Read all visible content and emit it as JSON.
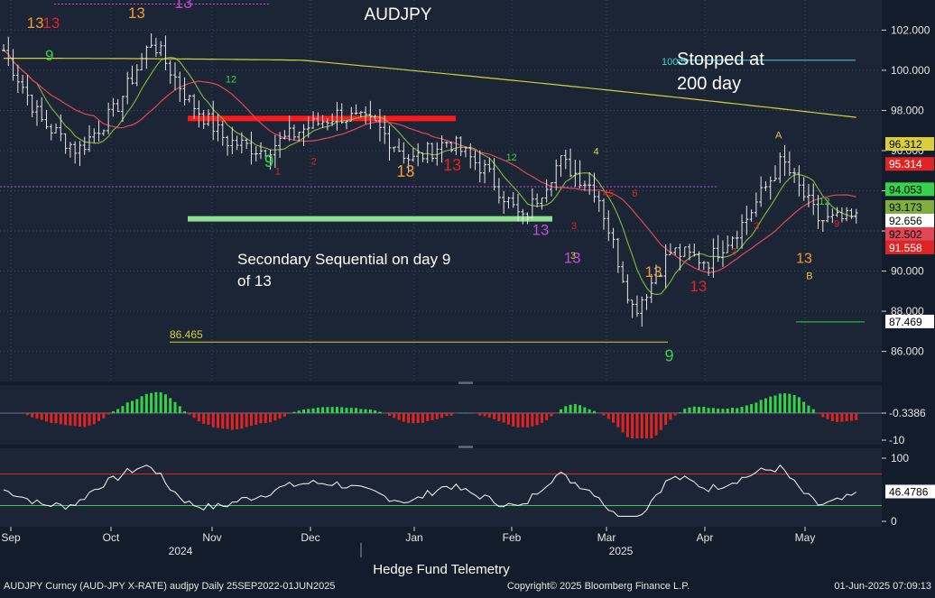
{
  "colors": {
    "bg": "#131c2b",
    "panel": "#1b2536",
    "grid": "#3a4558",
    "candle": "#e8e8e8",
    "ma_red": "#e0485a",
    "ma_green": "#7fae3c",
    "ma_yellow": "#d9cf3a",
    "hist_pos": "#35d24a",
    "hist_neg": "#e02424",
    "rsi_line": "#ffffff",
    "rsi_upper": "#e02424",
    "rsi_lower": "#35d24a",
    "text": "#e6e6e6"
  },
  "chart_data": {
    "type": "candlestick",
    "title": "AUDJPY",
    "x_ticks": [
      "Sep",
      "Oct",
      "Nov",
      "Dec",
      "Jan",
      "Feb",
      "Mar",
      "Apr",
      "May"
    ],
    "year_labels": [
      "2024",
      "2025"
    ],
    "ylim": [
      84.5,
      103.5
    ],
    "y_ticks": [
      "102.000",
      "100.000",
      "98.000",
      "96.000",
      "94.000",
      "92.000",
      "90.000",
      "88.000",
      "86.000"
    ],
    "annotations": {
      "stopped": "Stopped at\n200 day",
      "stopped_level": "100.5",
      "secondary": "Secondary Sequential on day 9\nof 13",
      "level_86": "86.465"
    },
    "price_labels": [
      {
        "text": "96.312",
        "value": 96.312,
        "bg": "#d9cf3a",
        "fg": "#000000"
      },
      {
        "text": "95.314",
        "value": 95.314,
        "bg": "#e02424",
        "fg": "#ffffff"
      },
      {
        "text": "94.053",
        "value": 94.053,
        "bg": "#35d24a",
        "fg": "#000000"
      },
      {
        "text": "93.173",
        "value": 93.173,
        "bg": "#7fae3c",
        "fg": "#000000"
      },
      {
        "text": "92.502",
        "value": 92.502,
        "bg": "#e0485a",
        "fg": "#000000"
      },
      {
        "text": "92.656",
        "value": 92.656,
        "bg": "#ffffff",
        "fg": "#000000"
      },
      {
        "text": "91.558",
        "value": 91.558,
        "bg": "#e02424",
        "fg": "#ffffff"
      },
      {
        "text": "87.469",
        "value": 87.469,
        "bg": "#ffffff",
        "fg": "#000000"
      }
    ],
    "hist_ticks": [
      "-0.3386",
      "-10"
    ],
    "rsi_ticks": [
      "100",
      "46.4786",
      "0"
    ],
    "rsi_bands": [
      75,
      25
    ],
    "rsi_last": 46.4786,
    "anchors": [
      101,
      97.5,
      96,
      98,
      101.5,
      98.5,
      96.5,
      96,
      97,
      97.8,
      97.3,
      95.5,
      96.5,
      95,
      92.5,
      95.5,
      94,
      88,
      91,
      90.5,
      92.5,
      95.5,
      92.5,
      92.6
    ],
    "seq_counts": [
      {
        "t": "13",
        "x": 0.04,
        "v": 102.1,
        "c": "#f29a2e",
        "s": 17
      },
      {
        "t": "13",
        "x": 0.058,
        "v": 102.1,
        "c": "#e02424",
        "s": 17
      },
      {
        "t": "9",
        "x": 0.056,
        "v": 100.5,
        "c": "#35d24a",
        "s": 17
      },
      {
        "t": "13",
        "x": 0.155,
        "v": 102.6,
        "c": "#f29a2e",
        "s": 17
      },
      {
        "t": "13",
        "x": 0.208,
        "v": 103.1,
        "c": "#c24ad6",
        "s": 18
      },
      {
        "t": "9",
        "x": 0.305,
        "v": 95.2,
        "c": "#35d24a",
        "s": 19
      },
      {
        "t": "13",
        "x": 0.46,
        "v": 94.7,
        "c": "#f29a2e",
        "s": 18
      },
      {
        "t": "13",
        "x": 0.513,
        "v": 95.0,
        "c": "#e02424",
        "s": 18
      },
      {
        "t": "13",
        "x": 0.613,
        "v": 91.8,
        "c": "#c24ad6",
        "s": 17
      },
      {
        "t": "13",
        "x": 0.649,
        "v": 90.4,
        "c": "#c24ad6",
        "s": 17
      },
      {
        "t": "13",
        "x": 0.741,
        "v": 89.7,
        "c": "#f29a2e",
        "s": 17
      },
      {
        "t": "13",
        "x": 0.792,
        "v": 89.0,
        "c": "#e02424",
        "s": 17
      },
      {
        "t": "9",
        "x": 0.759,
        "v": 85.5,
        "c": "#35d24a",
        "s": 18
      },
      {
        "t": "13",
        "x": 0.912,
        "v": 90.4,
        "c": "#f29a2e",
        "s": 16
      },
      {
        "t": "B",
        "x": 0.918,
        "v": 89.6,
        "c": "#d9cf3a",
        "s": 11
      },
      {
        "t": "A",
        "x": 0.883,
        "v": 96.6,
        "c": "#d9cf3a",
        "s": 11
      },
      {
        "t": "1",
        "x": 0.315,
        "v": 94.8,
        "c": "#e02424",
        "s": 11
      },
      {
        "t": "2",
        "x": 0.356,
        "v": 95.3,
        "c": "#e02424",
        "s": 11
      },
      {
        "t": "3",
        "x": 0.651,
        "v": 92.1,
        "c": "#e02424",
        "s": 11
      },
      {
        "t": "45",
        "x": 0.69,
        "v": 93.7,
        "c": "#e02424",
        "s": 11
      },
      {
        "t": "6",
        "x": 0.72,
        "v": 93.7,
        "c": "#e02424",
        "s": 11
      },
      {
        "t": "2",
        "x": 0.832,
        "v": 90.8,
        "c": "#e02424",
        "s": 11
      },
      {
        "t": "3",
        "x": 0.858,
        "v": 92.1,
        "c": "#e02424",
        "s": 11
      },
      {
        "t": "9",
        "x": 0.949,
        "v": 92.2,
        "c": "#e02424",
        "s": 11
      },
      {
        "t": "12",
        "x": 0.262,
        "v": 99.4,
        "c": "#35d24a",
        "s": 11
      },
      {
        "t": "12",
        "x": 0.58,
        "v": 95.5,
        "c": "#35d24a",
        "s": 11
      },
      {
        "t": "12",
        "x": 0.935,
        "v": 93.3,
        "c": "#35d24a",
        "s": 11
      },
      {
        "t": "4",
        "x": 0.676,
        "v": 95.8,
        "c": "#d9cf3a",
        "s": 11
      },
      {
        "t": "3",
        "x": 0.65,
        "v": 90.6,
        "c": "#d9cf3a",
        "s": 11
      }
    ]
  },
  "footer": {
    "left": "AUDJPY Curncy (AUD-JPY X-RATE) audjpy  Daily 25SEP2022-01JUN2025",
    "center_top": "Hedge Fund Telemetry",
    "center": "Copyright© 2025 Bloomberg Finance L.P.",
    "right": "01-Jun-2025 07:09:13"
  }
}
